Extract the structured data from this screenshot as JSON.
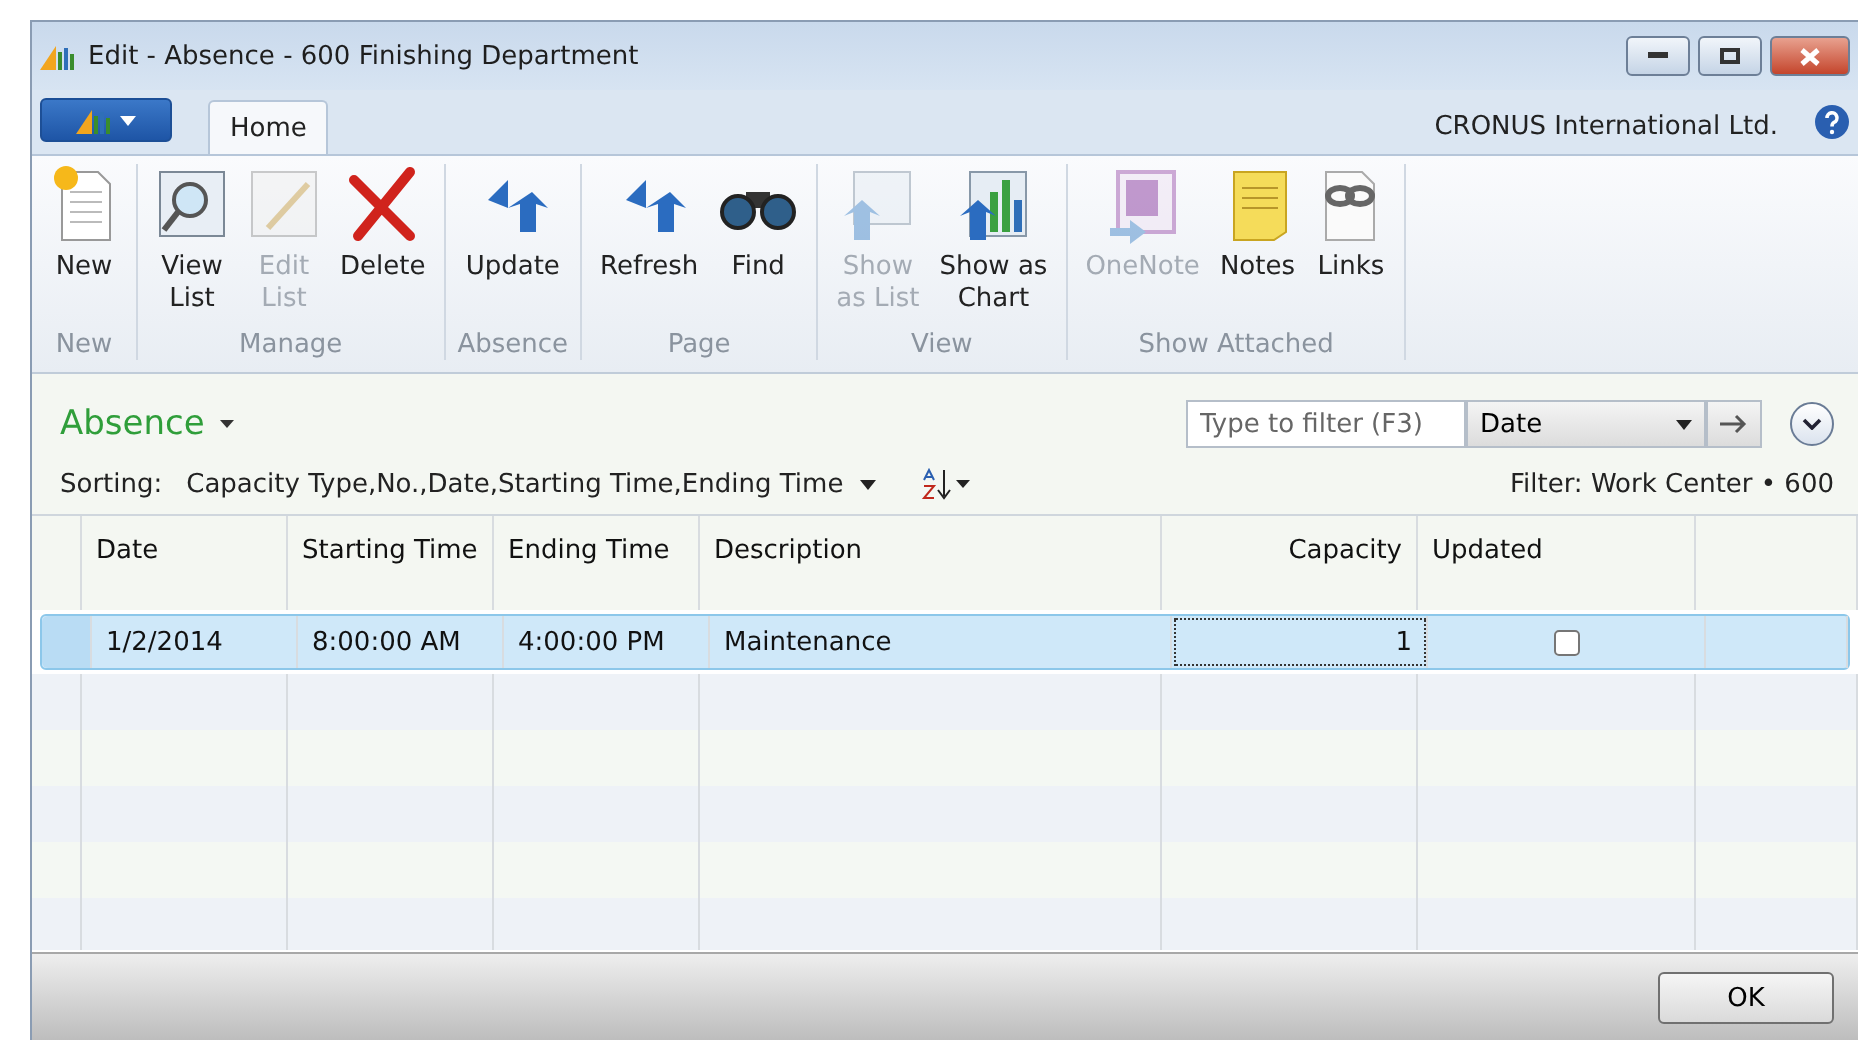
{
  "window": {
    "title": "Edit - Absence - 600 Finishing Department"
  },
  "tabs": [
    {
      "label": "Home",
      "selected": true
    }
  ],
  "company": "CRONUS International Ltd.",
  "ribbon": [
    {
      "label": "New",
      "items": [
        {
          "label": "New",
          "disabled": false
        }
      ]
    },
    {
      "label": "Manage",
      "items": [
        {
          "label": "View\nList",
          "disabled": false
        },
        {
          "label": "Edit\nList",
          "disabled": true
        },
        {
          "label": "Delete",
          "disabled": false
        }
      ]
    },
    {
      "label": "Absence",
      "items": [
        {
          "label": "Update",
          "disabled": false
        }
      ]
    },
    {
      "label": "Page",
      "items": [
        {
          "label": "Refresh",
          "disabled": false
        },
        {
          "label": "Find",
          "disabled": false
        }
      ]
    },
    {
      "label": "View",
      "items": [
        {
          "label": "Show\nas List",
          "disabled": true
        },
        {
          "label": "Show as\nChart",
          "disabled": false
        }
      ]
    },
    {
      "label": "Show Attached",
      "items": [
        {
          "label": "OneNote",
          "disabled": true
        },
        {
          "label": "Notes",
          "disabled": false
        },
        {
          "label": "Links",
          "disabled": false
        }
      ]
    }
  ],
  "page_title": "Absence",
  "filter": {
    "placeholder": "Type to filter (F3)",
    "field": "Date"
  },
  "sorting": {
    "label": "Sorting:",
    "value": "Capacity Type,No.,Date,Starting Time,Ending Time"
  },
  "filter_info": "Filter: Work Center • 600",
  "table": {
    "columns": [
      {
        "label": "Date",
        "kind": "text"
      },
      {
        "label": "Starting Time",
        "kind": "text"
      },
      {
        "label": "Ending Time",
        "kind": "text"
      },
      {
        "label": "Description",
        "kind": "text"
      },
      {
        "label": "Capacity",
        "kind": "number"
      },
      {
        "label": "Updated",
        "kind": "text"
      }
    ],
    "rows": [
      {
        "selected": true,
        "cells": [
          "1/2/2014",
          "8:00:00 AM",
          "4:00:00 PM",
          "Maintenance",
          "1"
        ],
        "updated": false
      }
    ]
  },
  "buttons": [
    "OK"
  ]
}
